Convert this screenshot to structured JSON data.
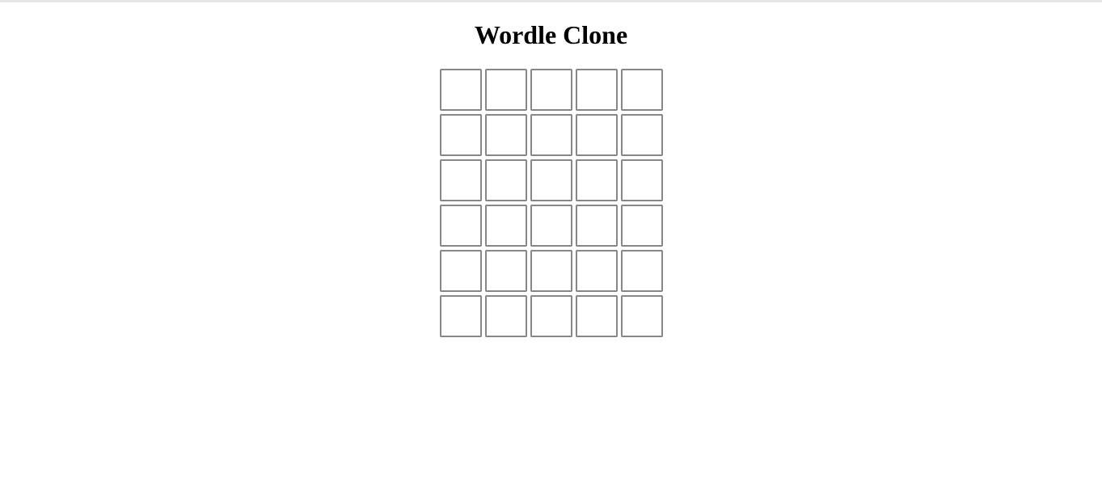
{
  "title": "Wordle Clone",
  "board": {
    "rows": [
      [
        "",
        "",
        "",
        "",
        ""
      ],
      [
        "",
        "",
        "",
        "",
        ""
      ],
      [
        "",
        "",
        "",
        "",
        ""
      ],
      [
        "",
        "",
        "",
        "",
        ""
      ],
      [
        "",
        "",
        "",
        "",
        ""
      ],
      [
        "",
        "",
        "",
        "",
        ""
      ]
    ]
  },
  "colors": {
    "tile_border": "#878787",
    "background": "#ffffff",
    "title": "#000000"
  }
}
